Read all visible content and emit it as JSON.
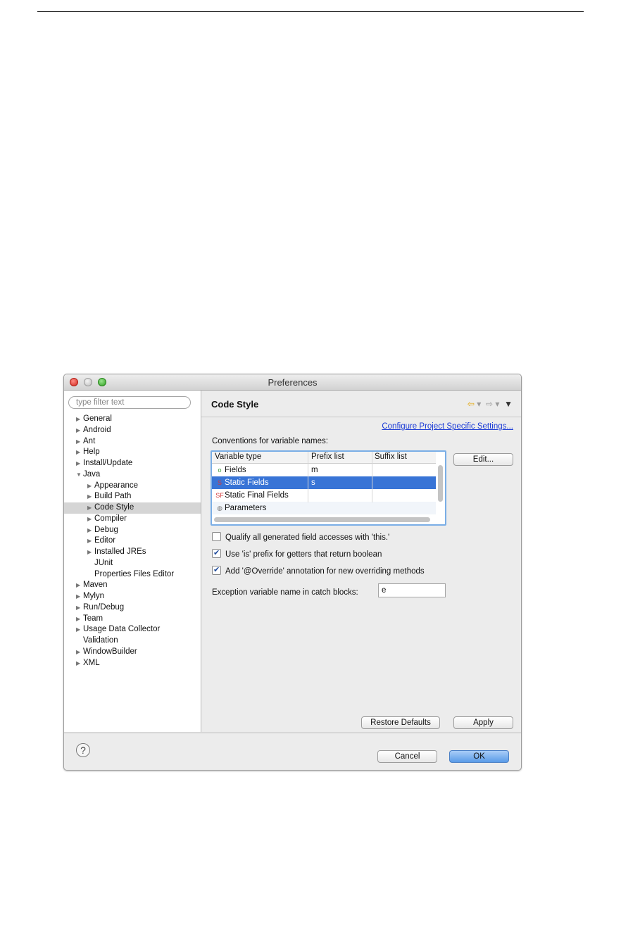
{
  "window": {
    "title": "Preferences"
  },
  "sidebar": {
    "filter_placeholder": "type filter text",
    "items": [
      {
        "label": "General",
        "arrow": "▶",
        "level": 0
      },
      {
        "label": "Android",
        "arrow": "▶",
        "level": 0
      },
      {
        "label": "Ant",
        "arrow": "▶",
        "level": 0
      },
      {
        "label": "Help",
        "arrow": "▶",
        "level": 0
      },
      {
        "label": "Install/Update",
        "arrow": "▶",
        "level": 0
      },
      {
        "label": "Java",
        "arrow": "▼",
        "level": 0
      },
      {
        "label": "Appearance",
        "arrow": "▶",
        "level": 1
      },
      {
        "label": "Build Path",
        "arrow": "▶",
        "level": 1
      },
      {
        "label": "Code Style",
        "arrow": "▶",
        "level": 1,
        "selected": true
      },
      {
        "label": "Compiler",
        "arrow": "▶",
        "level": 1
      },
      {
        "label": "Debug",
        "arrow": "▶",
        "level": 1
      },
      {
        "label": "Editor",
        "arrow": "▶",
        "level": 1
      },
      {
        "label": "Installed JREs",
        "arrow": "▶",
        "level": 1
      },
      {
        "label": "JUnit",
        "arrow": "",
        "level": 1
      },
      {
        "label": "Properties Files Editor",
        "arrow": "",
        "level": 1
      },
      {
        "label": "Maven",
        "arrow": "▶",
        "level": 0
      },
      {
        "label": "Mylyn",
        "arrow": "▶",
        "level": 0
      },
      {
        "label": "Run/Debug",
        "arrow": "▶",
        "level": 0
      },
      {
        "label": "Team",
        "arrow": "▶",
        "level": 0
      },
      {
        "label": "Usage Data Collector",
        "arrow": "▶",
        "level": 0
      },
      {
        "label": "Validation",
        "arrow": "",
        "level": 0
      },
      {
        "label": "WindowBuilder",
        "arrow": "▶",
        "level": 0
      },
      {
        "label": "XML",
        "arrow": "▶",
        "level": 0
      }
    ]
  },
  "content": {
    "title": "Code Style",
    "nav_back": "⇦",
    "nav_forward": "⇨",
    "nav_dropdown": "▾",
    "nav_menu": "▼",
    "configure_link": "Configure Project Specific Settings...",
    "conventions_label": "Conventions for variable names:",
    "table": {
      "headers": [
        "Variable type",
        "Prefix list",
        "Suffix list"
      ],
      "rows": [
        {
          "icon": "o",
          "icon_color": "#3a9c3a",
          "type": "Fields",
          "prefix": "m",
          "suffix": ""
        },
        {
          "icon": "S",
          "icon_color": "#d23b3b",
          "type": "Static Fields",
          "prefix": "s",
          "suffix": "",
          "selected": true
        },
        {
          "icon": "SF",
          "icon_color": "#d23b3b",
          "type": "Static Final Fields",
          "prefix": "",
          "suffix": ""
        },
        {
          "icon": "◍",
          "icon_color": "#777777",
          "type": "Parameters",
          "prefix": "",
          "suffix": ""
        }
      ]
    },
    "edit_button": "Edit...",
    "checkboxes": [
      {
        "label": "Qualify all generated field accesses with 'this.'",
        "checked": false
      },
      {
        "label": "Use 'is' prefix for getters that return boolean",
        "checked": true
      },
      {
        "label": "Add '@Override' annotation for new overriding methods",
        "checked": true
      }
    ],
    "exception_label": "Exception variable name in catch blocks:",
    "exception_value": "e",
    "restore_defaults": "Restore Defaults",
    "apply": "Apply"
  },
  "footer": {
    "help": "?",
    "cancel": "Cancel",
    "ok": "OK"
  },
  "colors": {
    "selection": "#3874d6",
    "link": "#1a3ad6",
    "ok_button": "#5a9be8"
  }
}
